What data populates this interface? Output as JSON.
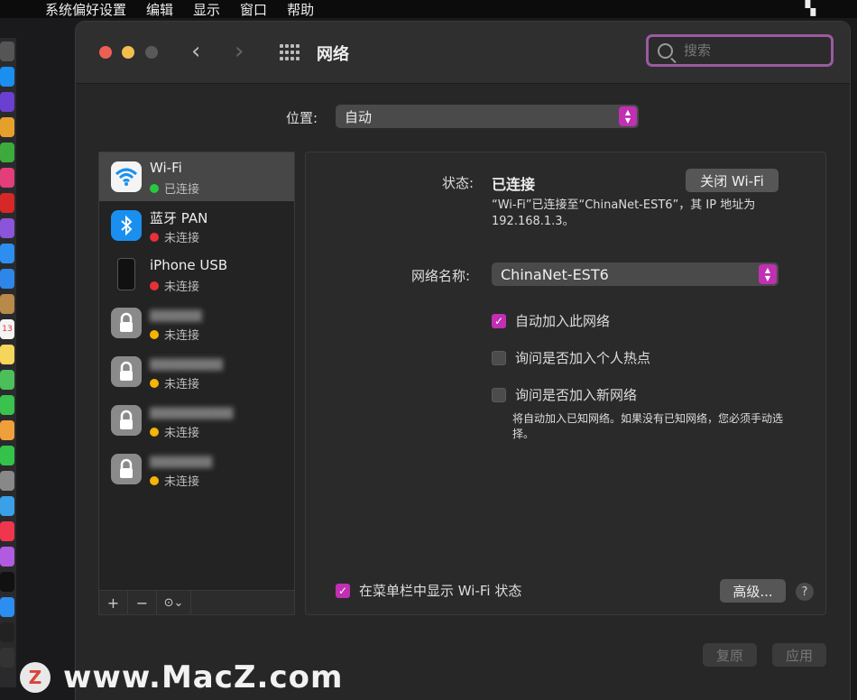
{
  "menubar": {
    "apple_icon": "apple-logo-icon",
    "items": [
      "系统偏好设置",
      "编辑",
      "显示",
      "窗口",
      "帮助"
    ]
  },
  "window": {
    "title": "网络",
    "search_placeholder": "搜索"
  },
  "location": {
    "label": "位置:",
    "value": "自动"
  },
  "services": [
    {
      "name": "Wi-Fi",
      "status": "已连接",
      "status_color": "#27c93f",
      "icon": "wifi-icon",
      "selected": true
    },
    {
      "name": "蓝牙 PAN",
      "status": "未连接",
      "status_color": "#e8303a",
      "icon": "bluetooth-icon",
      "selected": false
    },
    {
      "name": "iPhone USB",
      "status": "未连接",
      "status_color": "#e8303a",
      "icon": "iphone-icon",
      "selected": false
    },
    {
      "name": "",
      "status": "未连接",
      "status_color": "#f4b400",
      "icon": "lock-icon",
      "selected": false
    },
    {
      "name": "",
      "status": "未连接",
      "status_color": "#f4b400",
      "icon": "lock-icon",
      "selected": false
    },
    {
      "name": "",
      "status": "未连接",
      "status_color": "#f4b400",
      "icon": "lock-icon",
      "selected": false
    },
    {
      "name": "",
      "status": "未连接",
      "status_color": "#f4b400",
      "icon": "lock-icon",
      "selected": false
    }
  ],
  "sidebar_toolbar": {
    "add": "+",
    "remove": "−",
    "action": "⊙⌄"
  },
  "detail": {
    "status_label": "状态:",
    "status_value": "已连接",
    "turn_off_button": "关闭 Wi-Fi",
    "status_description": "“Wi-Fi”已连接至“ChinaNet-EST6”，其 IP 地址为 192.168.1.3。",
    "network_name_label": "网络名称:",
    "network_name_value": "ChinaNet-EST6",
    "auto_join_label": "自动加入此网络",
    "auto_join_checked": true,
    "ask_hotspot_label": "询问是否加入个人热点",
    "ask_hotspot_checked": false,
    "ask_new_label": "询问是否加入新网络",
    "ask_new_checked": false,
    "auto_join_note": "将自动加入已知网络。如果没有已知网络，您必须手动选择。",
    "show_in_menubar_label": "在菜单栏中显示 Wi-Fi 状态",
    "show_in_menubar_checked": true,
    "advanced_button": "高级...",
    "help_button": "?"
  },
  "footer": {
    "revert_button": "复原",
    "apply_button": "应用"
  },
  "watermark": {
    "logo_letter": "Z",
    "text": "www.MacZ.com"
  },
  "colors": {
    "accent": "#c12fb3",
    "search_border": "#9a5ba0"
  }
}
